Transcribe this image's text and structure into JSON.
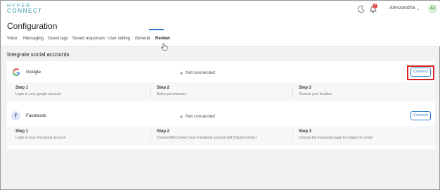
{
  "app": {
    "logo_line1": "HYPER",
    "logo_line2": "CONNECT",
    "notification_count": "2",
    "user_name": "Alexzandria",
    "avatar_initials": "AJ"
  },
  "page": {
    "title": "Configuration",
    "tabs": [
      {
        "label": "Voice"
      },
      {
        "label": "Messaging"
      },
      {
        "label": "Guest tags"
      },
      {
        "label": "Saved responses"
      },
      {
        "label": "User setting"
      },
      {
        "label": "General"
      },
      {
        "label": "Review",
        "active": true
      }
    ]
  },
  "social": {
    "section_title": "Integrate social accounts",
    "accounts": [
      {
        "name": "Google",
        "status": "Not connected",
        "button": "Connect",
        "highlighted": true,
        "steps": [
          {
            "title": "Step 1",
            "desc": "Login to your google account"
          },
          {
            "title": "Step 2",
            "desc": "Select permissions"
          },
          {
            "title": "Step 3",
            "desc": "Choose your location"
          }
        ]
      },
      {
        "name": "Facebook",
        "status": "Not connected",
        "button": "Connect",
        "highlighted": false,
        "steps": [
          {
            "title": "Step 1",
            "desc": "Login to your Facebook account"
          },
          {
            "title": "Step 2",
            "desc": "Connect/ReConnect your Facebook account with HyperConnect"
          },
          {
            "title": "Step 3",
            "desc": "Choose the Facebook page for logged in center"
          }
        ]
      }
    ]
  },
  "colors": {
    "accent": "#2f7fd1",
    "highlight": "#d92020",
    "logo": "#3ba6b6"
  },
  "icons": {
    "theme": "moon-icon",
    "notifications": "bell-icon",
    "google": "google-icon",
    "facebook": "facebook-icon",
    "pointer": "hand-cursor-icon"
  }
}
